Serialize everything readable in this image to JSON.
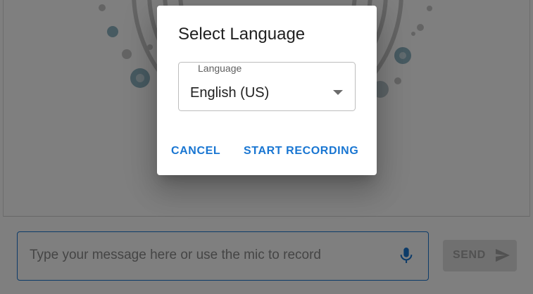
{
  "dialog": {
    "title": "Select Language",
    "language_select": {
      "label": "Language",
      "value": "English (US)"
    },
    "cancel_label": "CANCEL",
    "start_label": "START RECORDING"
  },
  "composer": {
    "placeholder": "Type your message here or use the mic to record",
    "send_label": "SEND"
  },
  "icons": {
    "mic": "mic-icon",
    "send": "send-icon",
    "dropdown": "arrow-drop-down-icon"
  },
  "colors": {
    "accent": "#1976d2",
    "scrim": "rgba(0,0,0,0.5)",
    "disabled_button": "#e0e0e0"
  }
}
